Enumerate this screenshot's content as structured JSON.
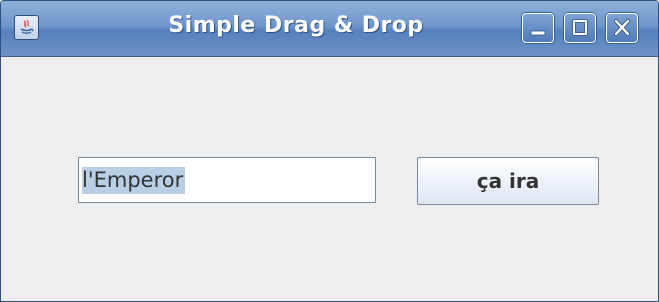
{
  "window": {
    "title": "Simple Drag & Drop",
    "controls": {
      "minimize": "minimize-icon",
      "maximize": "maximize-icon",
      "close": "close-icon"
    },
    "app_icon": "java-icon"
  },
  "main": {
    "text_field": {
      "value": "l'Emperor",
      "selected": true
    },
    "button": {
      "label": "ça ira"
    }
  },
  "colors": {
    "titlebar": "#6f97cc",
    "selection": "#b8cfe5",
    "background": "#eeeeee"
  }
}
